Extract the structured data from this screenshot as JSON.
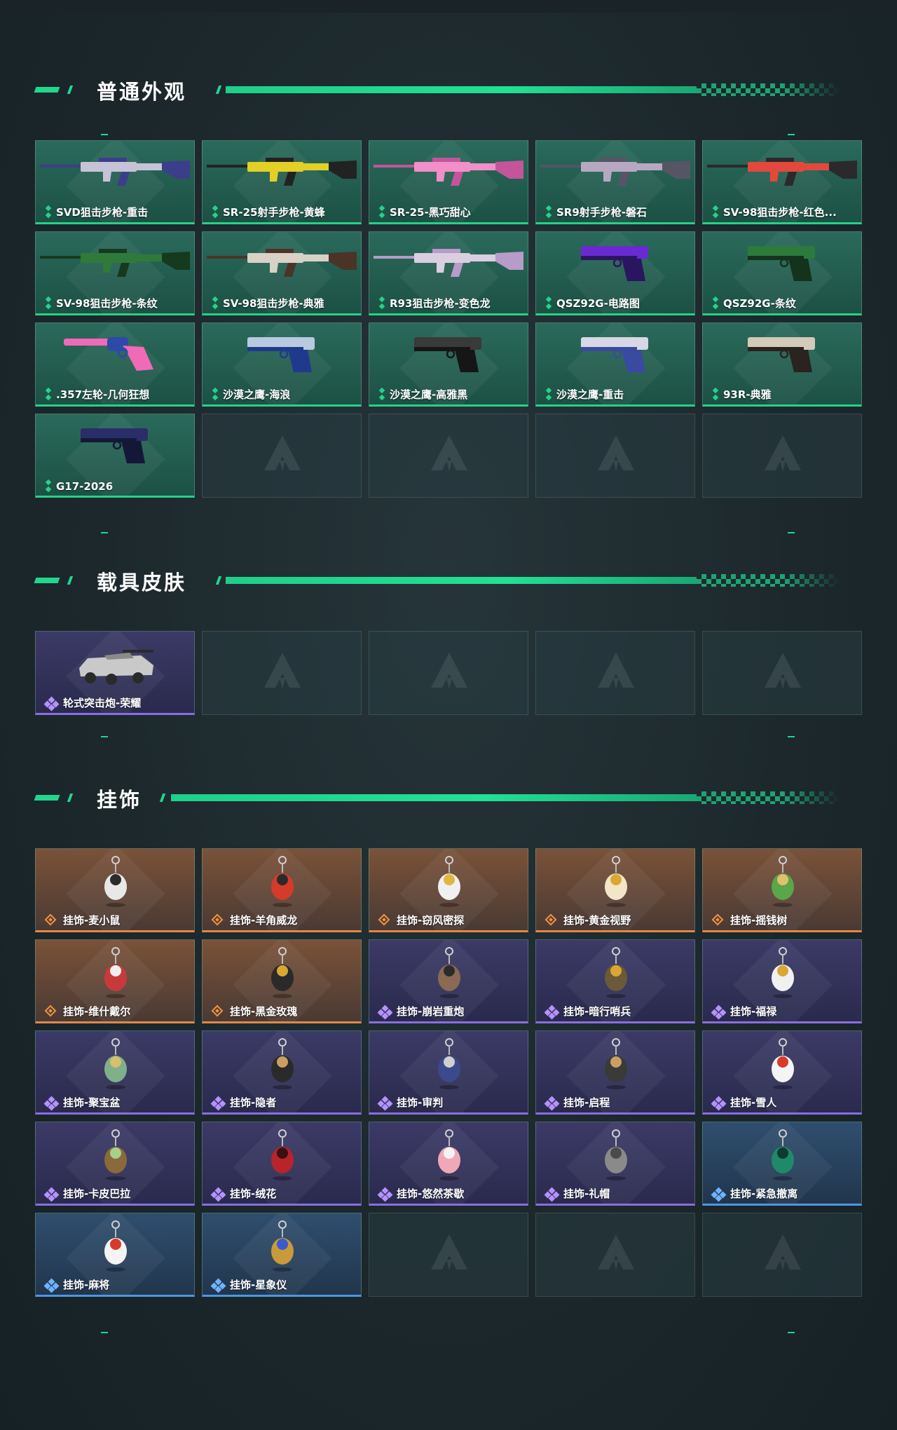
{
  "sections": [
    {
      "title": "普通外观",
      "items": [
        {
          "label": "SVD狙击步枪-重击",
          "rarity": "green",
          "kind": "rifle",
          "c1": "#c6c3d6",
          "c2": "#3b3f8a"
        },
        {
          "label": "SR-25射手步枪-黄蜂",
          "rarity": "green",
          "kind": "rifle",
          "c1": "#e3cf25",
          "c2": "#222222"
        },
        {
          "label": "SR-25-黑巧甜心",
          "rarity": "green",
          "kind": "rifle",
          "c1": "#f28ec8",
          "c2": "#c4559b"
        },
        {
          "label": "SR9射手步枪-磐石",
          "rarity": "green",
          "kind": "rifle",
          "c1": "#b7a8c2",
          "c2": "#555566"
        },
        {
          "label": "SV-98狙击步枪-红色...",
          "rarity": "green",
          "kind": "rifle",
          "c1": "#e2493c",
          "c2": "#2a2a2a"
        },
        {
          "label": "SV-98狙击步枪-条纹",
          "rarity": "green",
          "kind": "rifle",
          "c1": "#2f7a3a",
          "c2": "#163a1e"
        },
        {
          "label": "SV-98狙击步枪-典雅",
          "rarity": "green",
          "kind": "rifle",
          "c1": "#d8d2c6",
          "c2": "#4a3428"
        },
        {
          "label": "R93狙击步枪-变色龙",
          "rarity": "green",
          "kind": "rifle",
          "c1": "#d9cfe0",
          "c2": "#b79bc9"
        },
        {
          "label": "QSZ92G-电路图",
          "rarity": "green",
          "kind": "pistol",
          "c1": "#6a2ad1",
          "c2": "#2a1660"
        },
        {
          "label": "QSZ92G-条纹",
          "rarity": "green",
          "kind": "pistol",
          "c1": "#2c7a3c",
          "c2": "#14321c"
        },
        {
          "label": ".357左轮-几何狂想",
          "rarity": "green",
          "kind": "revolver",
          "c1": "#f06ab8",
          "c2": "#2d4aa8"
        },
        {
          "label": "沙漠之鹰-海浪",
          "rarity": "green",
          "kind": "pistol",
          "c1": "#b9c9df",
          "c2": "#1f3a8a"
        },
        {
          "label": "沙漠之鹰-高雅黑",
          "rarity": "green",
          "kind": "pistol",
          "c1": "#3a3a3a",
          "c2": "#161616"
        },
        {
          "label": "沙漠之鹰-重击",
          "rarity": "green",
          "kind": "pistol",
          "c1": "#d7d7e6",
          "c2": "#3a4aa0"
        },
        {
          "label": "93R-典雅",
          "rarity": "green",
          "kind": "pistol",
          "c1": "#d3cab8",
          "c2": "#2a2320"
        },
        {
          "label": "G17-2026",
          "rarity": "green",
          "kind": "pistol",
          "c1": "#2a2e68",
          "c2": "#141838"
        },
        {
          "label": "",
          "rarity": "empty"
        },
        {
          "label": "",
          "rarity": "empty"
        },
        {
          "label": "",
          "rarity": "empty"
        },
        {
          "label": "",
          "rarity": "empty"
        }
      ]
    },
    {
      "title": "载具皮肤",
      "items": [
        {
          "label": "轮式突击炮-荣耀",
          "rarity": "purple",
          "kind": "car",
          "c1": "#c9c9c9",
          "c2": "#2a2a2a"
        },
        {
          "label": "",
          "rarity": "empty"
        },
        {
          "label": "",
          "rarity": "empty"
        },
        {
          "label": "",
          "rarity": "empty"
        },
        {
          "label": "",
          "rarity": "empty"
        }
      ]
    },
    {
      "title": "挂饰",
      "items": [
        {
          "label": "挂饰-麦小鼠",
          "rarity": "orange",
          "kind": "charm",
          "c1": "#e8e8e8",
          "c2": "#2b2b2b"
        },
        {
          "label": "挂饰-羊角威龙",
          "rarity": "orange",
          "kind": "charm",
          "c1": "#d73a2a",
          "c2": "#2b2b2b"
        },
        {
          "label": "挂饰-窃风密探",
          "rarity": "orange",
          "kind": "charm",
          "c1": "#f0f0f0",
          "c2": "#e0b640"
        },
        {
          "label": "挂饰-黄金视野",
          "rarity": "orange",
          "kind": "charm",
          "c1": "#f3e6c8",
          "c2": "#d9a832"
        },
        {
          "label": "挂饰-摇钱树",
          "rarity": "orange",
          "kind": "charm",
          "c1": "#5aa64a",
          "c2": "#e0c070"
        },
        {
          "label": "挂饰-维什戴尔",
          "rarity": "orange",
          "kind": "charm",
          "c1": "#c83a3a",
          "c2": "#f0f0f0"
        },
        {
          "label": "挂饰-黑金玫瑰",
          "rarity": "orange",
          "kind": "charm",
          "c1": "#2a2a2a",
          "c2": "#d9a832"
        },
        {
          "label": "挂饰-崩岩重炮",
          "rarity": "purple",
          "kind": "charm",
          "c1": "#8a6a52",
          "c2": "#2b2b2b"
        },
        {
          "label": "挂饰-暗行哨兵",
          "rarity": "purple",
          "kind": "charm",
          "c1": "#6a5a3a",
          "c2": "#d9a832"
        },
        {
          "label": "挂饰-福禄",
          "rarity": "purple",
          "kind": "charm",
          "c1": "#f0f0f0",
          "c2": "#d9a832"
        },
        {
          "label": "挂饰-聚宝盆",
          "rarity": "purple",
          "kind": "charm",
          "c1": "#7fb08a",
          "c2": "#d9c06a"
        },
        {
          "label": "挂饰-隐者",
          "rarity": "purple",
          "kind": "charm",
          "c1": "#2a2a2a",
          "c2": "#c8a060"
        },
        {
          "label": "挂饰-审判",
          "rarity": "purple",
          "kind": "charm",
          "c1": "#3a4a8a",
          "c2": "#d0d0d0"
        },
        {
          "label": "挂饰-启程",
          "rarity": "purple",
          "kind": "charm",
          "c1": "#3a3a3a",
          "c2": "#c8a060"
        },
        {
          "label": "挂饰-雪人",
          "rarity": "purple",
          "kind": "charm",
          "c1": "#f4f4f4",
          "c2": "#d73a2a"
        },
        {
          "label": "挂饰-卡皮巴拉",
          "rarity": "purple",
          "kind": "charm",
          "c1": "#8a6a3a",
          "c2": "#a7d08a"
        },
        {
          "label": "挂饰-绒花",
          "rarity": "purple",
          "kind": "charm",
          "c1": "#b8242a",
          "c2": "#3a1010"
        },
        {
          "label": "挂饰-悠然茶歇",
          "rarity": "purple",
          "kind": "charm",
          "c1": "#f0a8b8",
          "c2": "#f4f4f4"
        },
        {
          "label": "挂饰-礼帽",
          "rarity": "purple",
          "kind": "charm",
          "c1": "#8a8a8a",
          "c2": "#4a4a4a"
        },
        {
          "label": "挂饰-紧急撤离",
          "rarity": "blue",
          "kind": "charm",
          "c1": "#1e8a6a",
          "c2": "#0f3a30"
        },
        {
          "label": "挂饰-麻将",
          "rarity": "blue",
          "kind": "charm",
          "c1": "#f4f4f4",
          "c2": "#d73a2a"
        },
        {
          "label": "挂饰-星象仪",
          "rarity": "blue",
          "kind": "charm",
          "c1": "#c89a3a",
          "c2": "#3a5ad0"
        },
        {
          "label": "",
          "rarity": "empty"
        },
        {
          "label": "",
          "rarity": "empty"
        },
        {
          "label": "",
          "rarity": "empty"
        }
      ]
    }
  ],
  "colors": {
    "accent": "#22d68e",
    "green": "#25d28a",
    "purple": "#8a6ee0",
    "orange": "#e38846",
    "blue": "#4f96e6"
  }
}
